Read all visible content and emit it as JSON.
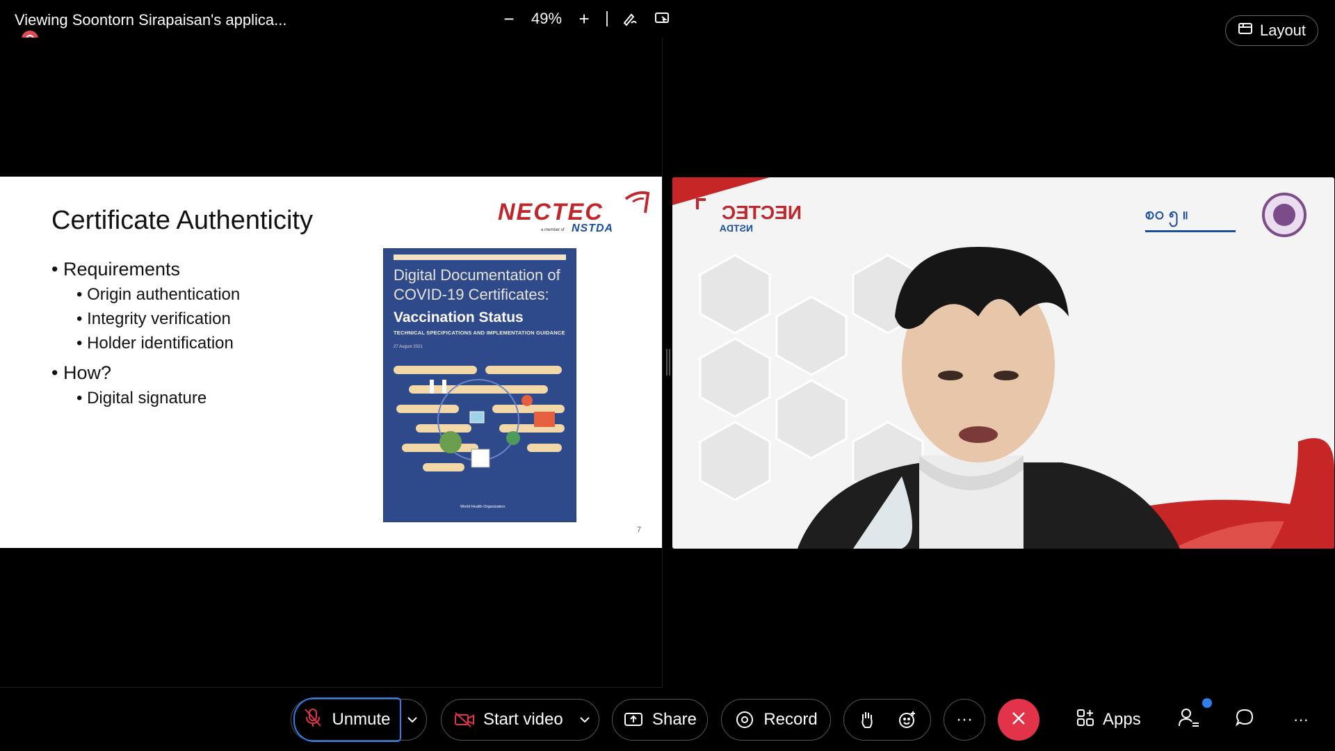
{
  "top_bar": {
    "share_title": "Viewing Soontorn Sirapaisan's applica...",
    "zoom_level": "49%",
    "layout_label": "Layout"
  },
  "slide": {
    "title": "Certificate Authenticity",
    "bullets": {
      "requirements": "Requirements",
      "origin": "Origin authentication",
      "integrity": "Integrity verification",
      "holder": "Holder identification",
      "how": "How?",
      "digital_signature": "Digital signature"
    },
    "logo_main": "NECTEC",
    "logo_sub_small": "a member of",
    "logo_sub": "NSTDA",
    "book": {
      "title": "Digital Documentation of COVID-19 Certificates:",
      "subtitle": "Vaccination Status",
      "spec": "TECHNICAL SPECIFICATIONS AND IMPLEMENTATION GUIDANCE",
      "date": "27 August 2021",
      "org": "World Health Organization"
    },
    "page_number": "7"
  },
  "video": {
    "logo_left": "NECTEC",
    "logo_left_sub": "NSTDA"
  },
  "toolbar": {
    "unmute_label": "Unmute",
    "start_video_label": "Start video",
    "share_label": "Share",
    "record_label": "Record",
    "more_label": "···",
    "apps_label": "Apps",
    "overflow_label": "···"
  },
  "colors": {
    "accent_blue": "#2f80ed",
    "leave_red": "#e2334a",
    "record_red": "#e04b5a",
    "nectec_red": "#c0272d",
    "nstda_blue": "#1a4f9c"
  }
}
